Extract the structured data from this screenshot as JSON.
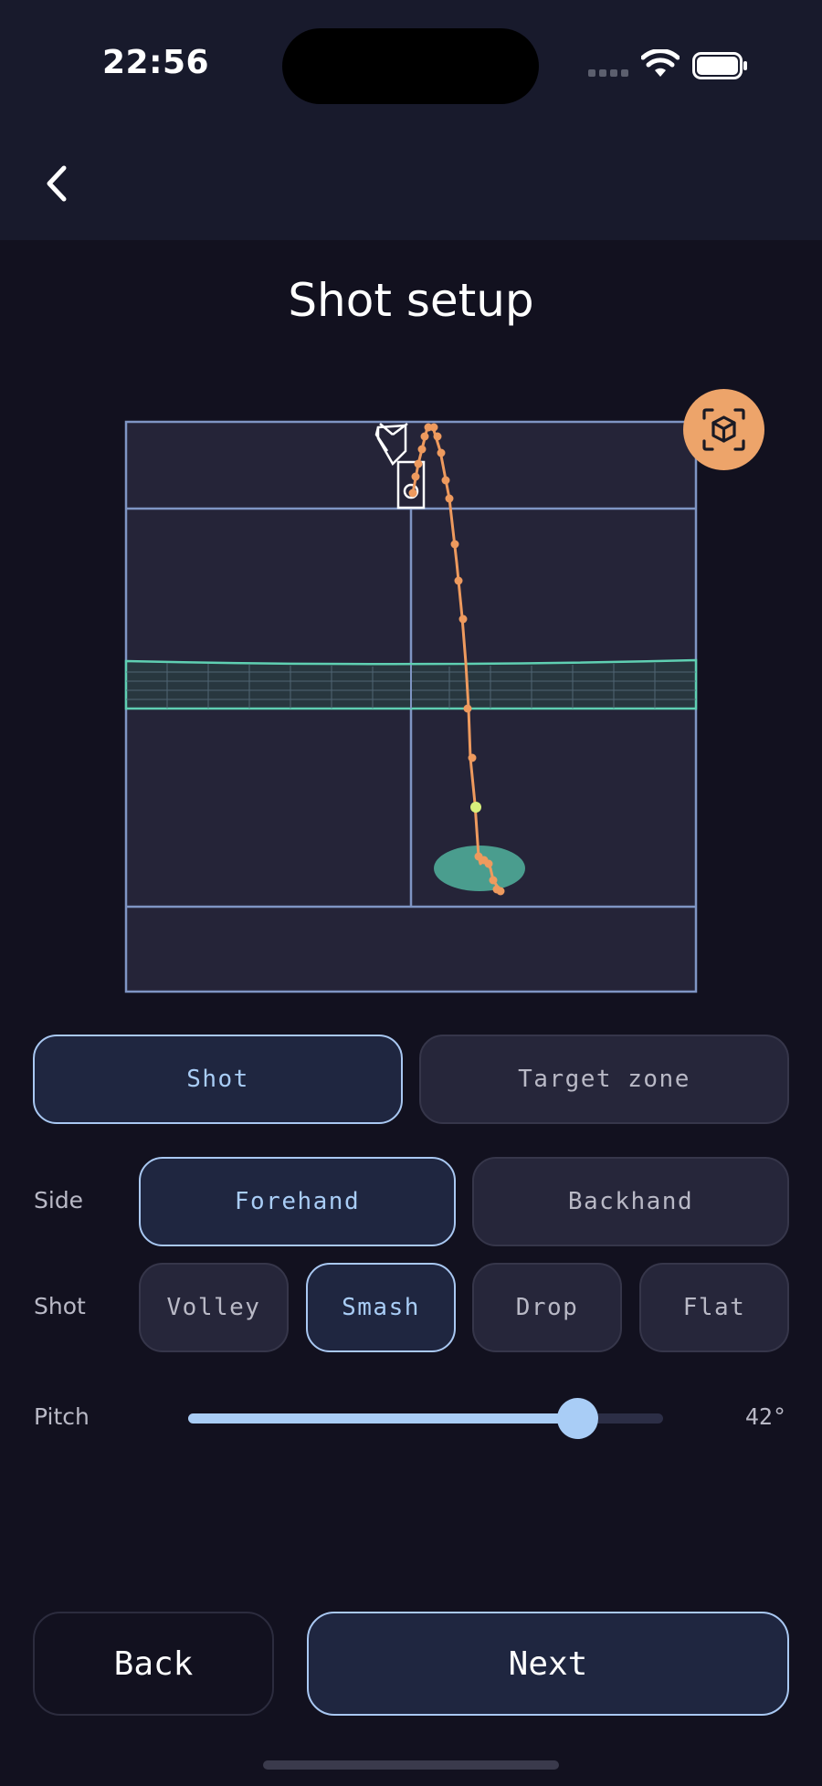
{
  "status_bar": {
    "time": "22:56"
  },
  "header": {
    "back_icon": "chevron-left-icon"
  },
  "page": {
    "title": "Shot setup"
  },
  "court": {
    "ar_icon": "ar-cube-icon",
    "colors": {
      "court_fill": "#252438",
      "lines": "#7f95c4",
      "net": "#5fd0b2",
      "trajectory": "#ee9a5e",
      "ball": "#d8f07c",
      "target_zone": "#4a9d8e"
    }
  },
  "mode_tabs": [
    {
      "label": "Shot",
      "active": true
    },
    {
      "label": "Target zone",
      "active": false
    }
  ],
  "side": {
    "label": "Side",
    "options": [
      {
        "label": "Forehand",
        "active": true
      },
      {
        "label": "Backhand",
        "active": false
      }
    ]
  },
  "shot": {
    "label": "Shot",
    "options": [
      {
        "label": "Volley",
        "active": false
      },
      {
        "label": "Smash",
        "active": true
      },
      {
        "label": "Drop",
        "active": false
      },
      {
        "label": "Flat",
        "active": false
      }
    ]
  },
  "pitch": {
    "label": "Pitch",
    "value_text": "42°",
    "fraction": 0.82
  },
  "footer": {
    "back_label": "Back",
    "next_label": "Next"
  },
  "colors": {
    "accent": "#a9cdf6",
    "background": "#12111f",
    "ar_button": "#eda46a"
  }
}
